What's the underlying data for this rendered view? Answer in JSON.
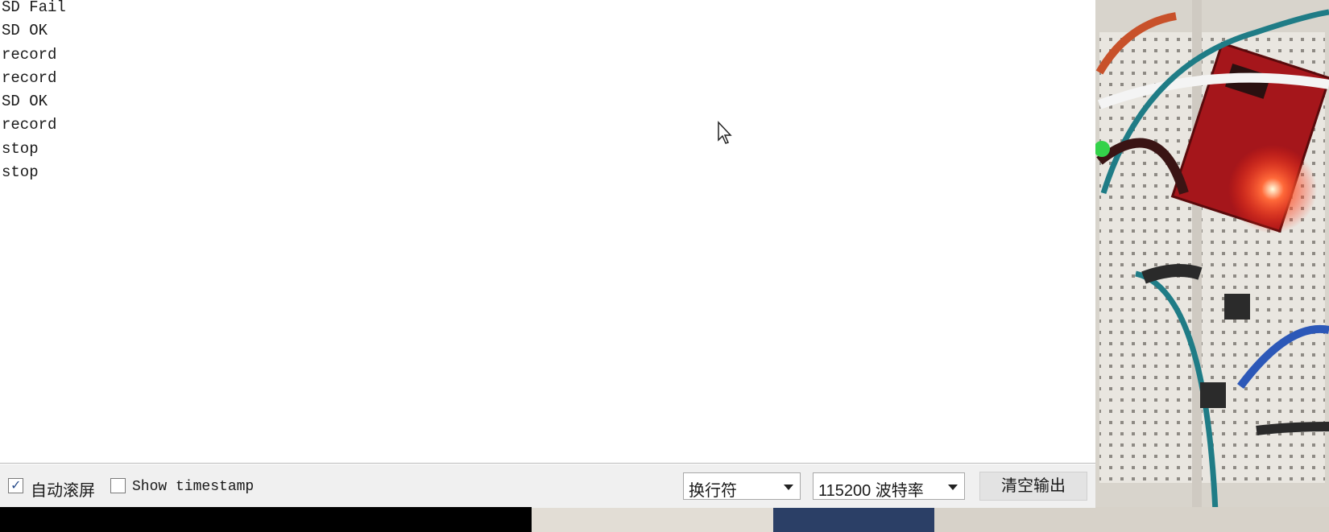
{
  "serial_monitor": {
    "output_lines": [
      "SD Fail",
      "SD OK",
      "record",
      "record",
      "SD OK",
      "record",
      "stop",
      "stop"
    ]
  },
  "bottom_bar": {
    "autoscroll_label": "自动滚屏",
    "autoscroll_checked": true,
    "timestamp_label": "Show timestamp",
    "timestamp_checked": false,
    "line_ending_value": "换行符",
    "baud_rate_value": "115200 波特率",
    "clear_output_label": "清空输出"
  },
  "icons": {
    "cursor": "mouse-pointer-icon",
    "checkbox_tick": "check-icon",
    "dropdown": "chevron-down-icon"
  },
  "colors": {
    "led_glow": "#ff3a1a",
    "board_red": "#b3141a",
    "wire_teal": "#1f7c86"
  }
}
